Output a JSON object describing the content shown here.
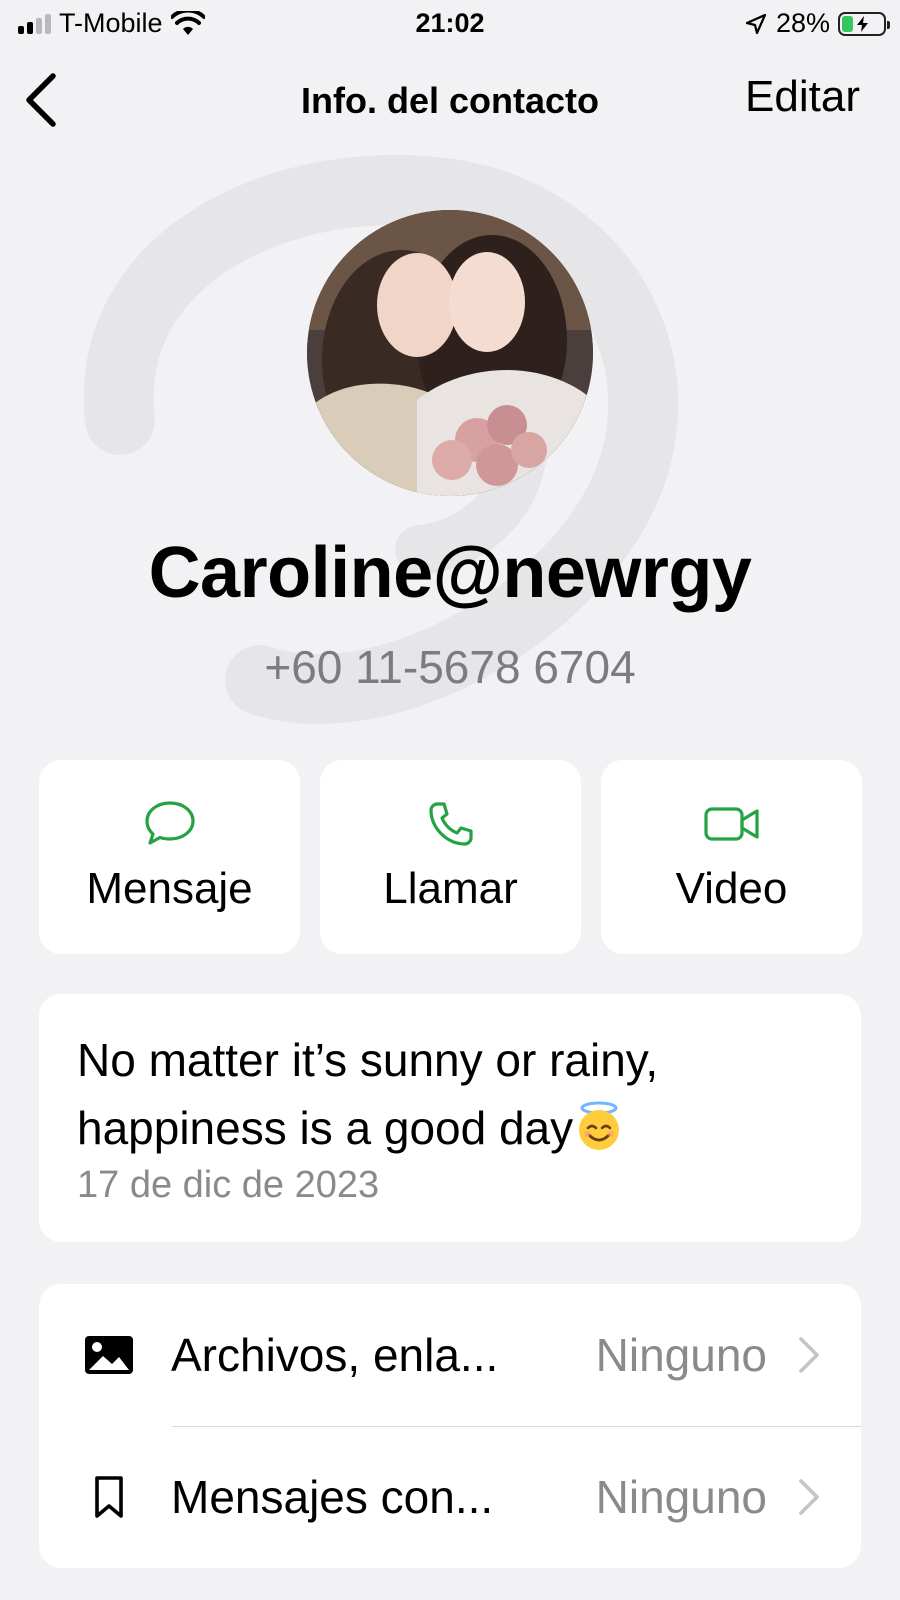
{
  "status_bar": {
    "carrier": "T-Mobile",
    "time": "21:02",
    "battery_percent": "28%",
    "battery_level": 0.28,
    "icons": [
      "signal-icon",
      "wifi-icon",
      "location-arrow-icon",
      "battery-charging-icon"
    ]
  },
  "nav": {
    "title": "Info. del contacto",
    "edit_label": "Editar"
  },
  "contact": {
    "name": "Caroline@newrgy",
    "phone": "+60 11-5678 6704"
  },
  "actions": [
    {
      "label": "Mensaje",
      "icon": "message-bubble-icon"
    },
    {
      "label": "Llamar",
      "icon": "phone-icon"
    },
    {
      "label": "Video",
      "icon": "video-camera-icon"
    }
  ],
  "about": {
    "text": "No matter it’s sunny or rainy, happiness is a good day",
    "emoji": "smiling-face-with-halo",
    "date": "17 de dic de 2023"
  },
  "list": [
    {
      "label": "Archivos, enla...",
      "value": "Ninguno",
      "icon": "image-icon"
    },
    {
      "label": "Mensajes con...",
      "value": "Ninguno",
      "icon": "bookmark-icon"
    }
  ],
  "colors": {
    "accent": "#25a244",
    "background": "#f2f2f4",
    "secondary_text": "#8a8a8e",
    "battery_charging": "#34c759"
  }
}
